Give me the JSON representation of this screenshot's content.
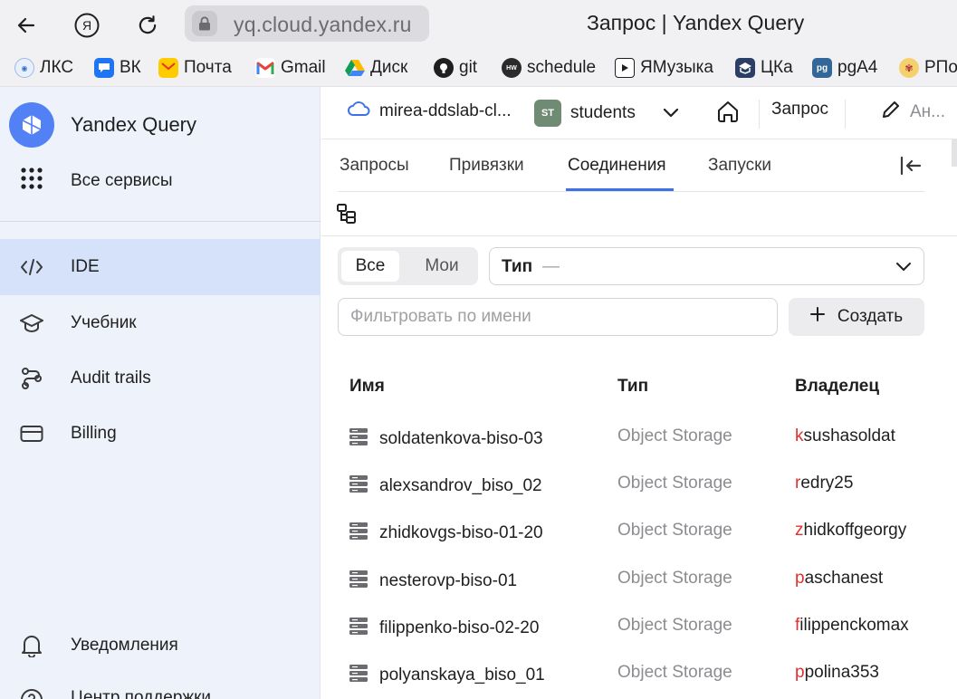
{
  "browser": {
    "url": "yq.cloud.yandex.ru",
    "page_title": "Запрос | Yandex Query",
    "bookmarks": [
      {
        "label": "ЛКС",
        "icon": "lks-icon"
      },
      {
        "label": "ВК",
        "icon": "vk-icon"
      },
      {
        "label": "Почта",
        "icon": "mail-icon"
      },
      {
        "label": "Gmail",
        "icon": "gmail-icon"
      },
      {
        "label": "Диск",
        "icon": "drive-icon"
      },
      {
        "label": "git",
        "icon": "github-icon"
      },
      {
        "label": "schedule",
        "icon": "schedule-icon"
      },
      {
        "label": "ЯМузыка",
        "icon": "music-icon"
      },
      {
        "label": "ЦКа",
        "icon": "cka-icon"
      },
      {
        "label": "pgA4",
        "icon": "pga4-icon"
      },
      {
        "label": "РПо",
        "icon": "rpo-icon"
      }
    ]
  },
  "sidebar": {
    "brand": "Yandex Query",
    "all_services": "Все сервисы",
    "items": [
      {
        "label": "IDE",
        "icon": "code-icon",
        "active": true
      },
      {
        "label": "Учебник",
        "icon": "graduation-cap-icon"
      },
      {
        "label": "Audit trails",
        "icon": "audit-trails-icon"
      },
      {
        "label": "Billing",
        "icon": "card-icon"
      }
    ],
    "notifications": "Уведомления",
    "support": "Центр поддержки"
  },
  "header": {
    "cloud": "mirea-ddslab-cl...",
    "folder_badge": "ST",
    "folder": "students",
    "query": "Запрос",
    "rename": "Ан..."
  },
  "tabs": [
    {
      "label": "Запросы"
    },
    {
      "label": "Привязки"
    },
    {
      "label": "Соединения",
      "active": true
    },
    {
      "label": "Запуски"
    }
  ],
  "filters": {
    "seg_all": "Все",
    "seg_mine": "Мои",
    "type_label": "Тип",
    "type_value": "—",
    "search_placeholder": "Фильтровать по имени",
    "create": "Создать"
  },
  "table": {
    "headers": {
      "name": "Имя",
      "type": "Тип",
      "owner": "Владелец"
    },
    "rows": [
      {
        "name": "soldatenkova-biso-03",
        "type": "Object Storage",
        "owner_initial": "k",
        "owner_rest": "sushasoldat"
      },
      {
        "name": "alexsandrov_biso_02",
        "type": "Object Storage",
        "owner_initial": "r",
        "owner_rest": "edry25"
      },
      {
        "name": "zhidkovgs-biso-01-20",
        "type": "Object Storage",
        "owner_initial": "z",
        "owner_rest": "hidkoffgeorgy"
      },
      {
        "name": "nesterovp-biso-01",
        "type": "Object Storage",
        "owner_initial": "p",
        "owner_rest": "aschanest"
      },
      {
        "name": "filippenko-biso-02-20",
        "type": "Object Storage",
        "owner_initial": "f",
        "owner_rest": "ilippenckomax"
      },
      {
        "name": "polyanskaya_biso_01",
        "type": "Object Storage",
        "owner_initial": "p",
        "owner_rest": "polina353"
      }
    ]
  },
  "colors": {
    "accent": "#3f71e6",
    "brand": "#5181f4",
    "owner_initial": "#e0312e",
    "sidebar_bg": "#eef2fb",
    "sidebar_active": "#d6e2f9"
  }
}
